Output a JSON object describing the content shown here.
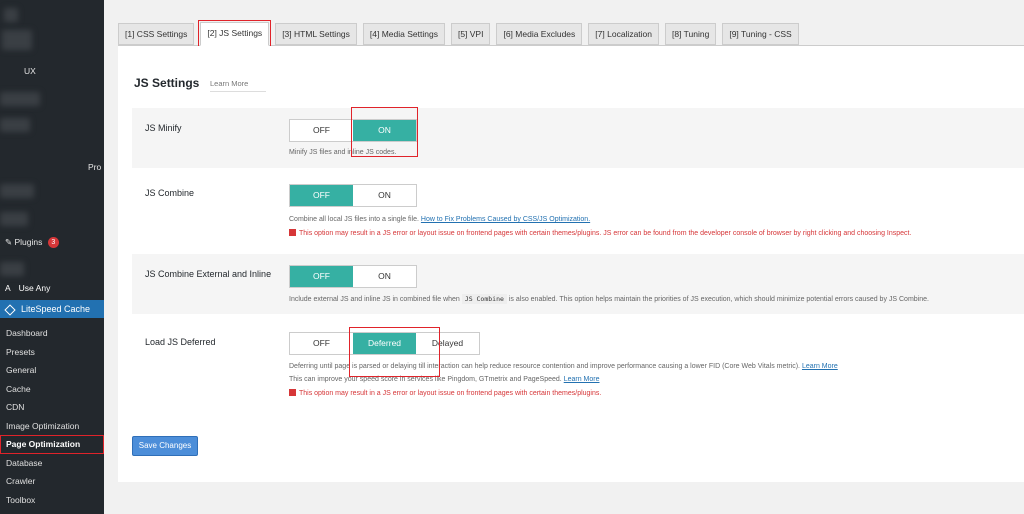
{
  "sidebar": {
    "items_top": [
      {
        "label": "UX"
      },
      {
        "label": "Pro"
      },
      {
        "label": "Plugins",
        "badge": "3"
      },
      {
        "label": "Use Any"
      }
    ],
    "plugin_header": "LiteSpeed Cache",
    "submenu": [
      "Dashboard",
      "Presets",
      "General",
      "Cache",
      "CDN",
      "Image Optimization",
      "Page Optimization",
      "Database",
      "Crawler",
      "Toolbox"
    ],
    "current": "Page Optimization"
  },
  "tabs": [
    "[1] CSS Settings",
    "[2] JS Settings",
    "[3] HTML Settings",
    "[4] Media Settings",
    "[5] VPI",
    "[6] Media Excludes",
    "[7] Localization",
    "[8] Tuning",
    "[9] Tuning - CSS"
  ],
  "active_tab": "[2] JS Settings",
  "section": {
    "title": "JS Settings",
    "learn_more": "Learn More"
  },
  "settings": {
    "js_minify": {
      "label": "JS Minify",
      "off": "OFF",
      "on": "ON",
      "selected": "ON",
      "desc": "Minify JS files and inline JS codes."
    },
    "js_combine": {
      "label": "JS Combine",
      "off": "OFF",
      "on": "ON",
      "selected": "OFF",
      "desc": "Combine all local JS files into a single file.",
      "link": "How to Fix Problems Caused by CSS/JS Optimization.",
      "warning": "This option may result in a JS error or layout issue on frontend pages with certain themes/plugins. JS error can be found from the developer console of browser by right clicking and choosing Inspect."
    },
    "js_combine_ext": {
      "label": "JS Combine External and Inline",
      "off": "OFF",
      "on": "ON",
      "selected": "OFF",
      "desc_pre": "Include external JS and inline JS in combined file when",
      "code": "JS Combine",
      "desc_post": "is also enabled. This option helps maintain the priorities of JS execution, which should minimize potential errors caused by JS Combine."
    },
    "load_js_deferred": {
      "label": "Load JS Deferred",
      "off": "OFF",
      "deferred": "Deferred",
      "delayed": "Delayed",
      "selected": "Deferred",
      "desc1": "Deferring until page is parsed or delaying till interaction can help reduce resource contention and improve performance causing a lower FID (Core Web Vitals metric).",
      "link1": "Learn More",
      "desc2": "This can improve your speed score in services like Pingdom, GTmetrix and PageSpeed.",
      "link2": "Learn More",
      "warning": "This option may result in a JS error or layout issue on frontend pages with certain themes/plugins."
    }
  },
  "save_button": "Save Changes",
  "colors": {
    "accent_toggle": "#36b0a3",
    "sidebar_bg": "#23282d",
    "plugin_header": "#2271b1",
    "highlight": "#e0232a",
    "warning": "#d63638"
  }
}
